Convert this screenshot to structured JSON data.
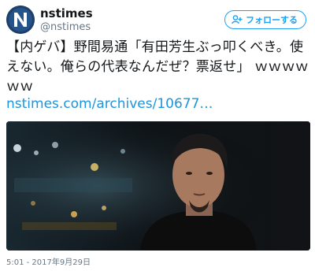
{
  "user": {
    "display_name": "nstimes",
    "screen_name": "@nstimes",
    "avatar_icon": "nst-logo-n"
  },
  "follow_button": {
    "label": "フォローする",
    "icon": "add-user-icon",
    "color": "#1da1f2"
  },
  "tweet": {
    "text": "【内ゲバ】野間易通「有田芳生ぶっ叩くべき。使えない。俺らの代表なんだぜ？票返せ」 ｗｗｗｗｗｗ",
    "link": "nstimes.com/archives/10677…",
    "link_color": "#1b95e0"
  },
  "media": {
    "description_icon": "photo-of-man-icon"
  },
  "timestamp": "5:01 - 2017年9月29日"
}
